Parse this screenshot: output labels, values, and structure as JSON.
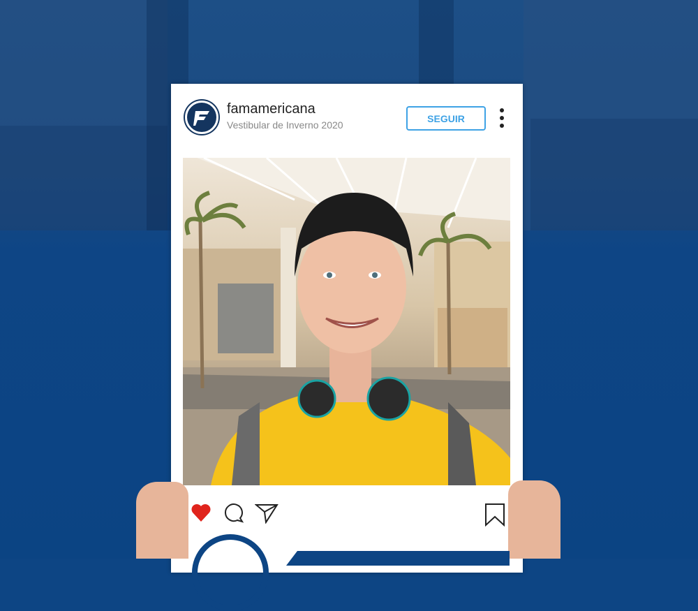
{
  "post": {
    "username": "famamericana",
    "subtitle": "Vestibular de Inverno 2020",
    "follow_label": "SEGUIR"
  },
  "icons": [
    "logo-icon",
    "more-options-icon",
    "heart-icon",
    "comment-icon",
    "share-icon",
    "bookmark-icon"
  ],
  "colors": {
    "background": "#0d4584",
    "follow": "#3ea2e5",
    "heart": "#e0241c",
    "shirt": "#f5c21b"
  }
}
